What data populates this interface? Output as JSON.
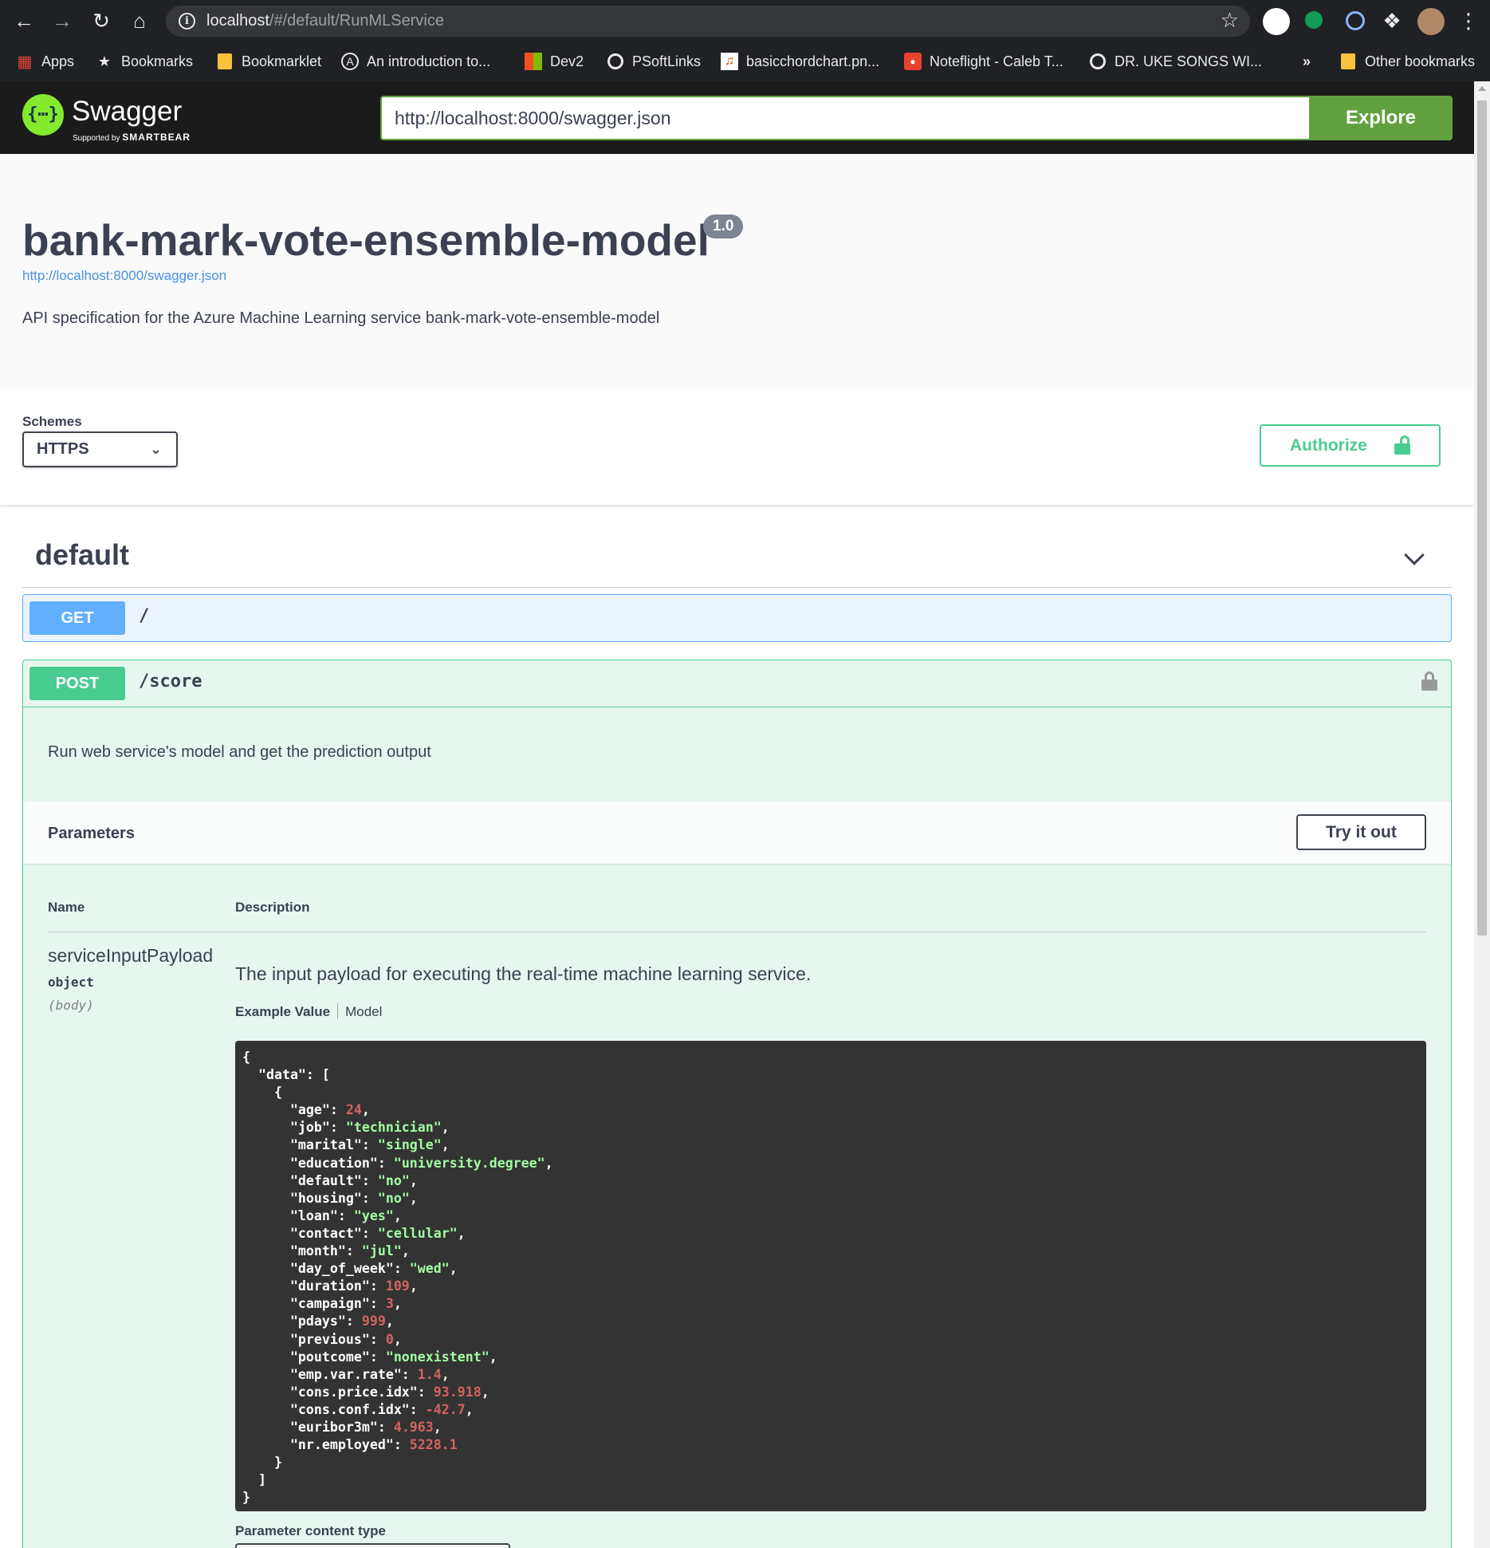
{
  "browser": {
    "url_host": "localhost",
    "url_path": "/#/default/RunMLService",
    "bookmarks": [
      {
        "label": "Apps",
        "icon": "apps-grid-icon"
      },
      {
        "label": "Bookmarks",
        "icon": "star-icon"
      },
      {
        "label": "Bookmarklet",
        "icon": "folder-icon"
      },
      {
        "label": "An introduction to...",
        "icon": "site-icon"
      },
      {
        "label": "Dev2",
        "icon": "windows-icon"
      },
      {
        "label": "PSoftLinks",
        "icon": "globe-icon"
      },
      {
        "label": "basicchordchart.pn...",
        "icon": "image-icon"
      },
      {
        "label": "Noteflight - Caleb T...",
        "icon": "noteflight-icon"
      },
      {
        "label": "DR. UKE SONGS WI...",
        "icon": "globe-icon"
      },
      {
        "label": "Other bookmarks",
        "icon": "folder-icon"
      }
    ],
    "overflow_label": "»"
  },
  "topbar": {
    "logo_name": "Swagger",
    "logo_supported": "Supported by",
    "logo_brand": "SMARTBEAR",
    "spec_url": "http://localhost:8000/swagger.json",
    "explore_label": "Explore"
  },
  "info": {
    "title": "bank-mark-vote-ensemble-model",
    "version": "1.0",
    "spec_link": "http://localhost:8000/swagger.json",
    "description": "API specification for the Azure Machine Learning service bank-mark-vote-ensemble-model"
  },
  "schemes": {
    "label": "Schemes",
    "selected": "HTTPS",
    "authorize_label": "Authorize"
  },
  "tag": {
    "name": "default"
  },
  "operations": {
    "get": {
      "method": "GET",
      "path": "/"
    },
    "post": {
      "method": "POST",
      "path": "/score",
      "description": "Run web service's model and get the prediction output",
      "parameters_title": "Parameters",
      "try_it_out_label": "Try it out",
      "col_name": "Name",
      "col_description": "Description",
      "param": {
        "name": "serviceInputPayload",
        "type": "object",
        "in": "(body)",
        "description": "The input payload for executing the real-time machine learning service."
      },
      "tab_example": "Example Value",
      "tab_model": "Model",
      "example_fields": [
        {
          "key": "age",
          "value": "24",
          "kind": "n"
        },
        {
          "key": "job",
          "value": "technician",
          "kind": "s"
        },
        {
          "key": "marital",
          "value": "single",
          "kind": "s"
        },
        {
          "key": "education",
          "value": "university.degree",
          "kind": "s"
        },
        {
          "key": "default",
          "value": "no",
          "kind": "s"
        },
        {
          "key": "housing",
          "value": "no",
          "kind": "s"
        },
        {
          "key": "loan",
          "value": "yes",
          "kind": "s"
        },
        {
          "key": "contact",
          "value": "cellular",
          "kind": "s"
        },
        {
          "key": "month",
          "value": "jul",
          "kind": "s"
        },
        {
          "key": "day_of_week",
          "value": "wed",
          "kind": "s"
        },
        {
          "key": "duration",
          "value": "109",
          "kind": "n"
        },
        {
          "key": "campaign",
          "value": "3",
          "kind": "n"
        },
        {
          "key": "pdays",
          "value": "999",
          "kind": "n"
        },
        {
          "key": "previous",
          "value": "0",
          "kind": "n"
        },
        {
          "key": "poutcome",
          "value": "nonexistent",
          "kind": "s"
        },
        {
          "key": "emp.var.rate",
          "value": "1.4",
          "kind": "n"
        },
        {
          "key": "cons.price.idx",
          "value": "93.918",
          "kind": "n"
        },
        {
          "key": "cons.conf.idx",
          "value": "-42.7",
          "kind": "n"
        },
        {
          "key": "euribor3m",
          "value": "4.963",
          "kind": "n"
        },
        {
          "key": "nr.employed",
          "value": "5228.1",
          "kind": "n"
        }
      ],
      "example_root_key": "data",
      "content_type_label": "Parameter content type"
    }
  },
  "colors": {
    "get": "#61affe",
    "post": "#49cc90",
    "explore": "#62a03f",
    "code_bg": "#333333"
  }
}
